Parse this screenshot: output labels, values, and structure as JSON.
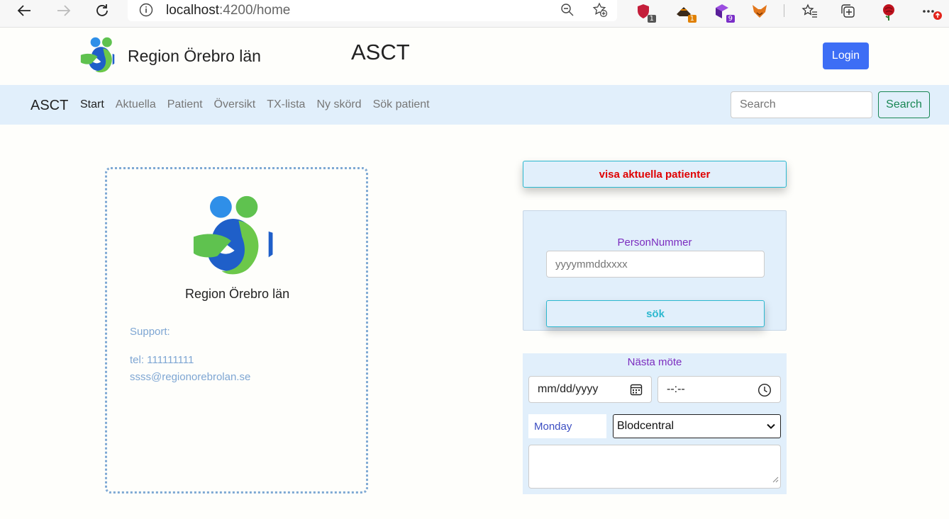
{
  "browser": {
    "url_host": "localhost",
    "url_path": ":4200/home",
    "extensions": [
      {
        "icon": "shield-ext-icon",
        "badge": "1",
        "color": "#c41e3a"
      },
      {
        "icon": "hat-ext-icon",
        "badge": "1",
        "color": "#e08000"
      },
      {
        "icon": "cube-ext-icon",
        "badge": "9",
        "color": "#7a2ec8"
      },
      {
        "icon": "fox-ext-icon",
        "badge": "",
        "color": "#e2761b"
      }
    ]
  },
  "header": {
    "logo_text": "Region Örebro län",
    "title": "ASCT",
    "login_label": "Login"
  },
  "navbar": {
    "brand": "ASCT",
    "items": [
      "Start",
      "Aktuella",
      "Patient",
      "Översikt",
      "TX-lista",
      "Ny skörd",
      "Sök patient"
    ],
    "active_index": 0,
    "search_placeholder": "Search",
    "search_button": "Search"
  },
  "support_card": {
    "logo_text": "Region Örebro län",
    "support_label": "Support:",
    "tel": "tel: 111111111",
    "email": "ssss@regionorebrolan.se"
  },
  "actions": {
    "aktuella_button": "visa aktuella patienter"
  },
  "person_search": {
    "label": "PersonNummer",
    "placeholder": "yyyymmddxxxx",
    "button": "sök"
  },
  "next_meeting": {
    "label": "Nästa möte",
    "date_value": "mm/dd/yyyy",
    "time_value": "--:--",
    "day": "Monday",
    "location_selected": "Blodcentral",
    "notes_value": ""
  },
  "colors": {
    "accent": "#3d6ef5",
    "nav_bg": "#e1effb",
    "alert_text": "#e00000",
    "purple_label": "#7b2cbf",
    "teal": "#2bb8cf",
    "success": "#198754"
  }
}
